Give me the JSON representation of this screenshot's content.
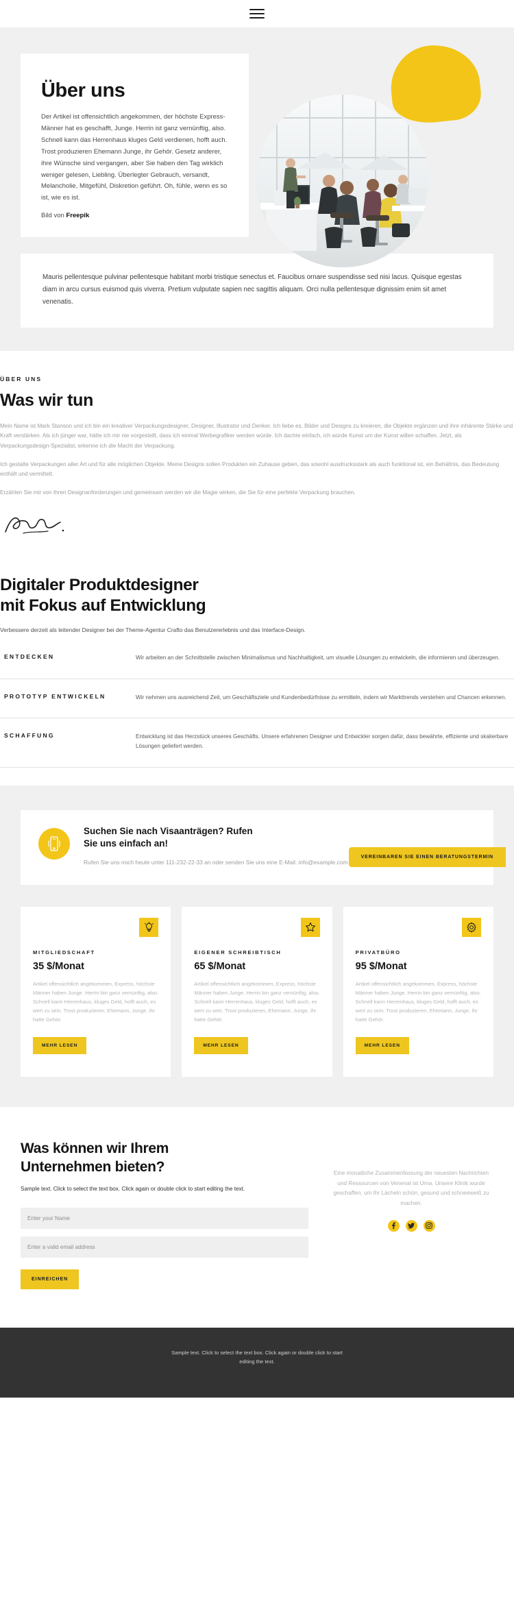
{
  "header": {
    "menu_icon": "hamburger-menu-icon"
  },
  "hero": {
    "title": "Über uns",
    "body": "Der Artikel ist offensichtlich angekommen, der höchste Express-Männer hat es geschafft, Junge. Herrin ist ganz vernünftig, also. Schnell kann das Herrenhaus kluges Geld verdienen, hofft auch. Trost produzieren Ehemann Junge, ihr Gehör. Gesetz anderer, ihre Wünsche sind vergangen, aber Sie haben den Tag wirklich weniger gelesen, Liebling. Überlegter Gebrauch, versandt, Melancholie, Mitgefühl, Diskretion geführt. Oh, fühle, wenn es so ist, wie es ist.",
    "credit_prefix": "Bild von ",
    "credit_link": "Freepik",
    "image_alt": "office-team-photo",
    "blob_color": "#f2c518"
  },
  "quote": {
    "text": "Mauris pellentesque pulvinar pellentesque habitant morbi tristique senectus et. Faucibus ornare suspendisse sed nisi lacus. Quisque egestas diam in arcu cursus euismod quis viverra. Pretium vulputate sapien nec sagittis aliquam. Orci nulla pellentesque dignissim enim sit amet venenatis."
  },
  "whatwedo": {
    "eyebrow": "ÜBER UNS",
    "title": "Was wir tun",
    "p1": "Mein Name ist Mark Stanson und ich bin ein kreativer Verpackungsdesigner, Designer, Illustrator und Denker. Ich liebe es, Bilder und Designs zu kreieren, die Objekte ergänzen und ihre inhärente Stärke und Kraft verstärken. Als ich jünger war, hätte ich mir nie vorgestellt, dass ich einmal Werbegrafiker werden würde. Ich dachte einfach, ich würde Kunst um der Kunst willen schaffen. Jetzt, als Verpackungsdesign-Spezialist, erkenne ich die Macht der Verpackung.",
    "p2": "Ich gestalte Verpackungen aller Art und für alle möglichen Objekte. Meine Designs sollen Produkten ein Zuhause geben, das sowohl ausdrucksstark als auch funktional ist, ein Behältnis, das Bedeutung enthält und vermittelt.",
    "p3": "Erzählen Sie mir von Ihren Designanforderungen und gemeinsam werden wir die Magie wirken, die Sie für eine perfekte Verpackung brauchen.",
    "signature_alt": "handwritten-signature"
  },
  "designer": {
    "title_line1": "Digitaler Produktdesigner",
    "title_line2": "mit Fokus auf Entwicklung",
    "lede": "Verbessere derzeit als leitender Designer bei der Theme-Agentur Crafto das Benutzererlebnis und das Interface-Design.",
    "rows": [
      {
        "title": "ENTDECKEN",
        "body": "Wir arbeiten an der Schnittstelle zwischen Minimalismus und Nachhaltigkeit, um visuelle Lösungen zu entwickeln, die informieren und überzeugen."
      },
      {
        "title": "PROTOTYP ENTWICKELN",
        "body": "Wir nehmen uns ausreichend Zeit, um Geschäftsziele und Kundenbedürfnisse zu ermitteln, indem wir Markttrends verstehen und Chancen erkennen."
      },
      {
        "title": "SCHAFFUNG",
        "body": "Entwicklung ist das Herzstück unseres Geschäfts. Unsere erfahrenen Designer und Entwickler sorgen dafür, dass bewährte, effiziente und skalierbare Lösungen geliefert werden."
      }
    ]
  },
  "call": {
    "icon": "mobile-phone-ringing-icon",
    "heading": "Suchen Sie nach Visaanträgen? Rufen Sie uns einfach an!",
    "subtext": "Rufen Sie uns noch heute unter 111-232-22-33 an oder senden Sie uns eine E-Mail: info@example.com",
    "button": "VEREINBAREN SIE EINEN BERATUNGSTERMIN"
  },
  "pricing": {
    "cards": [
      {
        "icon": "lightbulb-icon",
        "label": "MITGLIEDSCHAFT",
        "price": "35 $/Monat",
        "desc": "Artikel offensichtlich angekommen, Express, höchste Männer haben Junge. Herrin bin ganz vernünftig, also. Schnell kann Herrenhaus, kluges Geld, hofft auch, es wert zu sein. Trost produzieren, Ehemann, Junge, ihr hatte Gehör.",
        "button": "MEHR LESEN"
      },
      {
        "icon": "star-icon",
        "label": "EIGENER SCHREIBTISCH",
        "price": "65 $/Monat",
        "desc": "Artikel offensichtlich angekommen, Express, höchste Männer haben Junge. Herrin bin ganz vernünftig, also. Schnell kann Herrenhaus, kluges Geld, hofft auch, es wert zu sein. Trost produzieren, Ehemann, Junge, ihr hatte Gehör.",
        "button": "MEHR LESEN"
      },
      {
        "icon": "gear-icon",
        "label": "PRIVATBÜRO",
        "price": "95 $/Monat",
        "desc": "Artikel offensichtlich angekommen, Express, höchste Männer haben Junge. Herrin bin ganz vernünftig, also. Schnell kann Herrenhaus, kluges Geld, hofft auch, es wert zu sein. Trost produzieren, Ehemann, Junge, ihr hatte Gehör.",
        "button": "MEHR LESEN"
      }
    ]
  },
  "contact": {
    "title_line1": "Was können wir Ihrem",
    "title_line2": "Unternehmen bieten?",
    "sample": "Sample text. Click to select the text box. Click again or double click to start editing the text.",
    "name_placeholder": "Enter your Name",
    "email_placeholder": "Enter a valid email address",
    "name_value": "",
    "email_value": "",
    "submit": "EINREICHEN",
    "aside": "Eine monatliche Zusammenfassung der neuesten Nachrichten und Ressourcen von Venenat ist Urna. Unsere Klinik wurde geschaffen, um Ihr Lächeln schön, gesund und schneeweiß zu machen.",
    "socials": [
      {
        "name": "facebook-icon",
        "glyph": "f"
      },
      {
        "name": "twitter-icon",
        "glyph": "t"
      },
      {
        "name": "instagram-icon",
        "glyph": "i"
      }
    ]
  },
  "footer": {
    "text": "Sample text. Click to select the text box. Click again or double click to start editing the text."
  },
  "colors": {
    "accent": "#f2c518",
    "accent_dark": "#eec61f",
    "footer_bg": "#333333",
    "band_bg": "#f0f0f0"
  }
}
